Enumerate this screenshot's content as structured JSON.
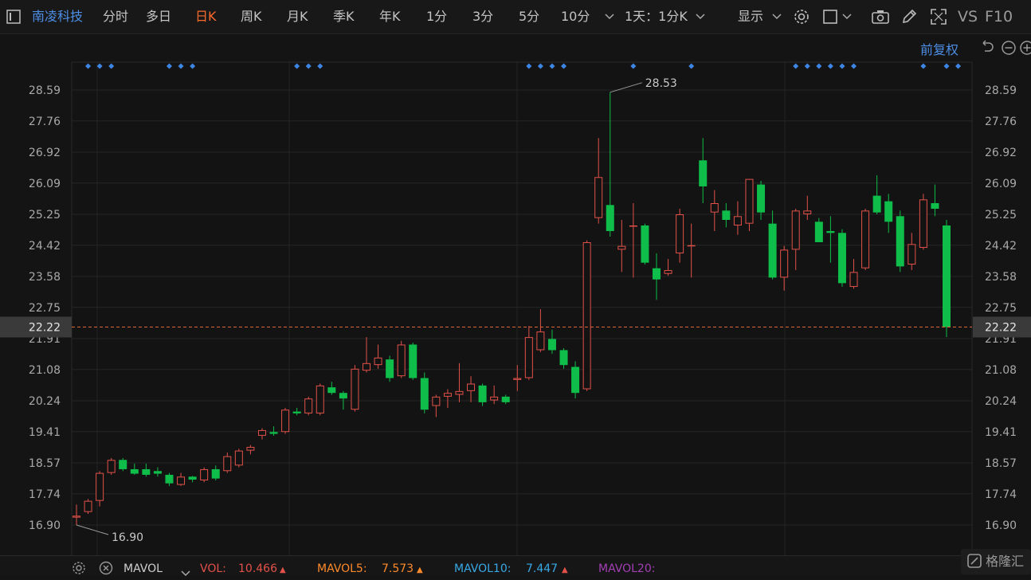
{
  "toolbar": {
    "stock_name": "南凌科技",
    "periods": [
      "分时",
      "多日",
      "日K",
      "周K",
      "月K",
      "季K",
      "年K",
      "1分",
      "3分",
      "5分",
      "10分"
    ],
    "active_period": "日K",
    "interval_label": "1天：1分K",
    "display_label": "显示",
    "vs_label": "VS",
    "f10_label": "F10"
  },
  "subbar": {
    "adjust_label": "前复权"
  },
  "chart_data": {
    "type": "candlestick",
    "y_ticks": [
      "28.59",
      "27.76",
      "26.92",
      "26.09",
      "25.25",
      "24.42",
      "23.58",
      "22.75",
      "21.91",
      "21.08",
      "20.24",
      "19.41",
      "18.57",
      "17.74",
      "16.90"
    ],
    "ylim": [
      16.9,
      28.59
    ],
    "current_price": "22.22",
    "max_label": "28.53",
    "min_label": "16.90",
    "up_color": "#e2514a",
    "down_color": "#0fbd4a",
    "candles": [
      {
        "o": 17.1,
        "h": 17.45,
        "l": 16.9,
        "c": 17.15
      },
      {
        "o": 17.25,
        "h": 17.6,
        "l": 17.2,
        "c": 17.55
      },
      {
        "o": 17.55,
        "h": 18.35,
        "l": 17.4,
        "c": 18.3
      },
      {
        "o": 18.3,
        "h": 18.7,
        "l": 18.25,
        "c": 18.65
      },
      {
        "o": 18.65,
        "h": 18.7,
        "l": 18.35,
        "c": 18.4
      },
      {
        "o": 18.4,
        "h": 18.55,
        "l": 18.25,
        "c": 18.28
      },
      {
        "o": 18.4,
        "h": 18.55,
        "l": 18.2,
        "c": 18.25
      },
      {
        "o": 18.35,
        "h": 18.45,
        "l": 18.2,
        "c": 18.28
      },
      {
        "o": 18.25,
        "h": 18.3,
        "l": 17.95,
        "c": 18.02
      },
      {
        "o": 17.98,
        "h": 18.3,
        "l": 17.95,
        "c": 18.2
      },
      {
        "o": 18.2,
        "h": 18.22,
        "l": 18.05,
        "c": 18.12
      },
      {
        "o": 18.1,
        "h": 18.45,
        "l": 18.05,
        "c": 18.4
      },
      {
        "o": 18.4,
        "h": 18.5,
        "l": 18.1,
        "c": 18.15
      },
      {
        "o": 18.35,
        "h": 18.85,
        "l": 18.3,
        "c": 18.75
      },
      {
        "o": 18.5,
        "h": 18.95,
        "l": 18.45,
        "c": 18.9
      },
      {
        "o": 18.9,
        "h": 19.05,
        "l": 18.8,
        "c": 19.0
      },
      {
        "o": 19.3,
        "h": 19.5,
        "l": 19.2,
        "c": 19.45
      },
      {
        "o": 19.4,
        "h": 19.55,
        "l": 19.3,
        "c": 19.35
      },
      {
        "o": 19.4,
        "h": 20.05,
        "l": 19.35,
        "c": 20.0
      },
      {
        "o": 19.95,
        "h": 20.05,
        "l": 19.85,
        "c": 19.9
      },
      {
        "o": 19.9,
        "h": 20.35,
        "l": 19.85,
        "c": 20.3
      },
      {
        "o": 19.9,
        "h": 20.7,
        "l": 19.85,
        "c": 20.65
      },
      {
        "o": 20.6,
        "h": 20.75,
        "l": 20.4,
        "c": 20.45
      },
      {
        "o": 20.45,
        "h": 20.5,
        "l": 20.0,
        "c": 20.3
      },
      {
        "o": 20.0,
        "h": 21.2,
        "l": 19.95,
        "c": 21.1
      },
      {
        "o": 21.05,
        "h": 21.95,
        "l": 21.0,
        "c": 21.25
      },
      {
        "o": 21.2,
        "h": 21.75,
        "l": 21.1,
        "c": 21.4
      },
      {
        "o": 21.35,
        "h": 21.45,
        "l": 20.75,
        "c": 20.85
      },
      {
        "o": 20.9,
        "h": 21.85,
        "l": 20.85,
        "c": 21.75
      },
      {
        "o": 21.75,
        "h": 21.8,
        "l": 20.8,
        "c": 20.85
      },
      {
        "o": 20.85,
        "h": 21.0,
        "l": 19.9,
        "c": 20.0
      },
      {
        "o": 20.1,
        "h": 20.4,
        "l": 19.8,
        "c": 20.35
      },
      {
        "o": 20.35,
        "h": 20.55,
        "l": 20.05,
        "c": 20.45
      },
      {
        "o": 20.4,
        "h": 21.25,
        "l": 20.2,
        "c": 20.5
      },
      {
        "o": 20.5,
        "h": 20.9,
        "l": 20.2,
        "c": 20.7
      },
      {
        "o": 20.65,
        "h": 20.7,
        "l": 20.1,
        "c": 20.2
      },
      {
        "o": 20.25,
        "h": 20.65,
        "l": 20.15,
        "c": 20.35
      },
      {
        "o": 20.35,
        "h": 20.4,
        "l": 20.15,
        "c": 20.2
      },
      {
        "o": 20.8,
        "h": 21.2,
        "l": 20.5,
        "c": 20.85
      },
      {
        "o": 20.85,
        "h": 22.25,
        "l": 20.8,
        "c": 21.95
      },
      {
        "o": 21.6,
        "h": 22.7,
        "l": 21.55,
        "c": 22.1
      },
      {
        "o": 21.9,
        "h": 22.15,
        "l": 21.5,
        "c": 21.6
      },
      {
        "o": 21.6,
        "h": 21.65,
        "l": 21.1,
        "c": 21.2
      },
      {
        "o": 21.15,
        "h": 21.3,
        "l": 20.3,
        "c": 20.45
      },
      {
        "o": 20.55,
        "h": 24.55,
        "l": 20.5,
        "c": 24.5
      },
      {
        "o": 25.15,
        "h": 27.3,
        "l": 25.0,
        "c": 26.25
      },
      {
        "o": 25.5,
        "h": 28.53,
        "l": 24.65,
        "c": 24.8
      },
      {
        "o": 24.3,
        "h": 25.1,
        "l": 23.7,
        "c": 24.4
      },
      {
        "o": 24.95,
        "h": 25.55,
        "l": 23.55,
        "c": 24.95
      },
      {
        "o": 24.95,
        "h": 25.0,
        "l": 23.9,
        "c": 23.95
      },
      {
        "o": 23.8,
        "h": 24.2,
        "l": 22.95,
        "c": 23.5
      },
      {
        "o": 23.65,
        "h": 24.05,
        "l": 23.6,
        "c": 23.75
      },
      {
        "o": 24.2,
        "h": 25.4,
        "l": 23.95,
        "c": 25.25
      },
      {
        "o": 24.42,
        "h": 25.0,
        "l": 23.55,
        "c": 24.42
      },
      {
        "o": 26.7,
        "h": 27.3,
        "l": 25.55,
        "c": 26.0
      },
      {
        "o": 25.3,
        "h": 25.9,
        "l": 24.8,
        "c": 25.55
      },
      {
        "o": 25.35,
        "h": 25.55,
        "l": 24.9,
        "c": 25.1
      },
      {
        "o": 24.95,
        "h": 25.6,
        "l": 24.7,
        "c": 25.2
      },
      {
        "o": 25.0,
        "h": 26.2,
        "l": 24.8,
        "c": 26.2
      },
      {
        "o": 26.05,
        "h": 26.15,
        "l": 25.1,
        "c": 25.3
      },
      {
        "o": 25.0,
        "h": 25.35,
        "l": 23.5,
        "c": 23.55
      },
      {
        "o": 23.55,
        "h": 24.4,
        "l": 23.2,
        "c": 24.3
      },
      {
        "o": 24.3,
        "h": 25.4,
        "l": 23.75,
        "c": 25.35
      },
      {
        "o": 25.25,
        "h": 25.75,
        "l": 25.1,
        "c": 25.35
      },
      {
        "o": 25.05,
        "h": 25.15,
        "l": 24.5,
        "c": 24.5
      },
      {
        "o": 24.8,
        "h": 25.2,
        "l": 23.95,
        "c": 24.75
      },
      {
        "o": 24.75,
        "h": 24.85,
        "l": 23.3,
        "c": 23.4
      },
      {
        "o": 23.3,
        "h": 24.05,
        "l": 23.25,
        "c": 23.7
      },
      {
        "o": 23.8,
        "h": 25.4,
        "l": 23.75,
        "c": 25.35
      },
      {
        "o": 25.75,
        "h": 26.3,
        "l": 25.25,
        "c": 25.3
      },
      {
        "o": 25.6,
        "h": 25.8,
        "l": 24.75,
        "c": 25.05
      },
      {
        "o": 25.2,
        "h": 25.35,
        "l": 23.7,
        "c": 23.85
      },
      {
        "o": 23.9,
        "h": 24.75,
        "l": 23.75,
        "c": 24.45
      },
      {
        "o": 24.35,
        "h": 25.8,
        "l": 24.3,
        "c": 25.65
      },
      {
        "o": 25.55,
        "h": 26.05,
        "l": 25.2,
        "c": 25.4
      },
      {
        "o": 24.95,
        "h": 25.1,
        "l": 21.95,
        "c": 22.22
      }
    ],
    "event_marker_columns": [
      1,
      2,
      3,
      8,
      9,
      10,
      19,
      20,
      21,
      39,
      40,
      41,
      42,
      48,
      53,
      62,
      63,
      64,
      65,
      66,
      67,
      73,
      75,
      76
    ]
  },
  "bottom": {
    "mavol_label": "MAVOL",
    "vol_label": "VOL:",
    "vol_value": "10.466",
    "vol_color": "#e2514a",
    "mavol5_label": "MAVOL5:",
    "mavol5_value": "7.573",
    "mavol5_color": "#ff8a2b",
    "mavol10_label": "MAVOL10:",
    "mavol10_value": "7.447",
    "mavol10_color": "#38a9e6",
    "mavol20_label": "MAVOL20:",
    "mavol20_color": "#a23fb3"
  },
  "watermark": {
    "text": "格隆汇"
  }
}
